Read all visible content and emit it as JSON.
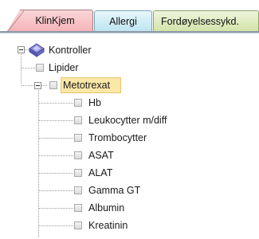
{
  "tabs": [
    {
      "label": "KlinKjem",
      "state": "selected"
    },
    {
      "label": "Allergi"
    },
    {
      "label": "Fordøyelsessykd."
    }
  ],
  "tree": {
    "root": {
      "label": "Kontroller",
      "icon": "diamond-folder-icon"
    },
    "children": [
      {
        "label": "Lipider"
      },
      {
        "label": "Metotrexat",
        "selected": true,
        "children": [
          {
            "label": "Hb"
          },
          {
            "label": "Leukocytter m/diff"
          },
          {
            "label": "Trombocytter"
          },
          {
            "label": "ASAT"
          },
          {
            "label": "ALAT"
          },
          {
            "label": "Gamma GT"
          },
          {
            "label": "Albumin"
          },
          {
            "label": "Kreatinin"
          }
        ]
      }
    ]
  },
  "colors": {
    "tab_klinkjem": "#f4b4b8",
    "tab_allergi": "#bfe4f1",
    "tab_fordoyelse": "#d3e3a9",
    "selection": "#fbe7a8"
  }
}
